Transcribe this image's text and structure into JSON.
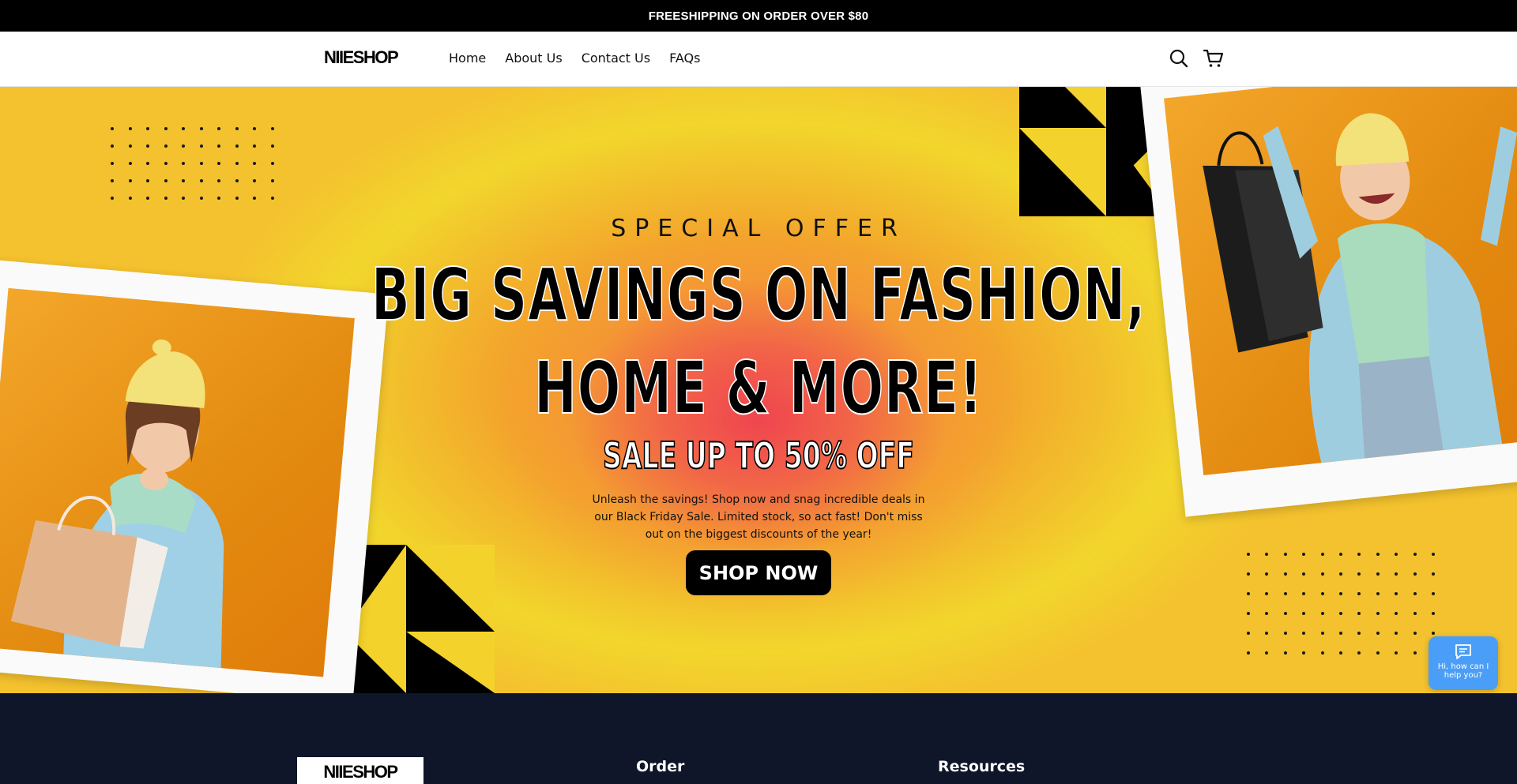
{
  "announcement": {
    "text": "FREESHIPPING ON ORDER OVER $80"
  },
  "header": {
    "logo": "NIIESHOP",
    "nav": [
      "Home",
      "About Us",
      "Contact Us",
      "FAQs"
    ],
    "icons": [
      "search-icon",
      "cart-icon"
    ]
  },
  "hero": {
    "eyebrow": "SPECIAL OFFER",
    "headline_line1": "BIG SAVINGS ON FASHION,",
    "headline_line2": "HOME & MORE!",
    "sale": "SALE UP TO 50% OFF",
    "description": "Unleash the savings! Shop now and snag incredible deals in our Black Friday Sale. Limited stock, so act fast! Don't miss out on the biggest discounts of the year!",
    "cta": "SHOP NOW"
  },
  "chat": {
    "text": "Hi, how can I help you?",
    "icon": "chat-bubble-icon"
  },
  "footer": {
    "logo": "NIIESHOP",
    "headings": [
      "Order",
      "Resources"
    ]
  },
  "colors": {
    "accent_yellow": "#f4d22c",
    "accent_orange": "#f58a3a",
    "accent_red": "#f0454f",
    "chat_blue": "#4a9ef7",
    "footer_bg": "#0f1629"
  }
}
